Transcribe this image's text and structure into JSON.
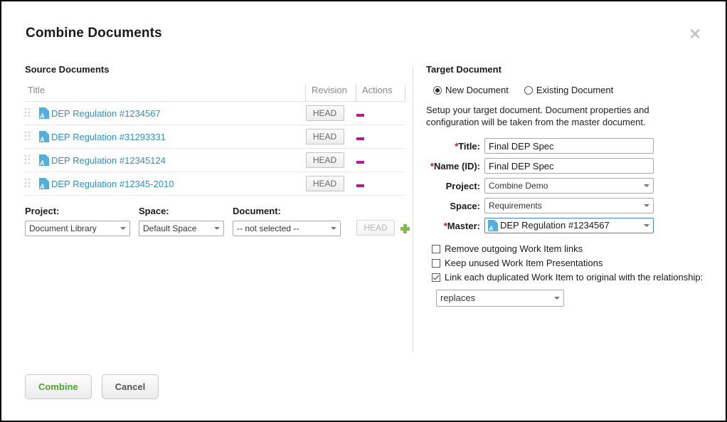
{
  "dialog": {
    "title": "Combine Documents",
    "close_icon": "close-icon"
  },
  "source": {
    "heading": "Source Documents",
    "columns": {
      "title": "Title",
      "revision": "Revision",
      "actions": "Actions"
    },
    "rows": [
      {
        "title": "DEP Regulation #1234567",
        "revision": "HEAD",
        "icon": "document-icon",
        "action_icon": "remove-icon"
      },
      {
        "title": "DEP Regulation #31293331",
        "revision": "HEAD",
        "icon": "document-icon",
        "action_icon": "remove-icon"
      },
      {
        "title": "DEP Regulation #12345124",
        "revision": "HEAD",
        "icon": "document-icon",
        "action_icon": "remove-icon"
      },
      {
        "title": "DEP Regulation #12345-2010",
        "revision": "HEAD",
        "icon": "document-icon",
        "action_icon": "remove-icon"
      }
    ],
    "selectors": {
      "project_label": "Project:",
      "project_value": "Document Library",
      "space_label": "Space:",
      "space_value": "Default Space",
      "document_label": "Document:",
      "document_value": "-- not selected --",
      "head_button": "HEAD",
      "add_icon": "plus-icon"
    }
  },
  "target": {
    "heading": "Target Document",
    "mode": {
      "new_label": "New Document",
      "existing_label": "Existing Document",
      "selected": "New Document"
    },
    "help_text": "Setup your target document. Document properties and configuration will be taken from the master document.",
    "fields": {
      "title_label": "Title:",
      "title_value": "Final DEP Spec",
      "name_label": "Name (ID):",
      "name_value": "Final DEP Spec",
      "project_label": "Project:",
      "project_value": "Combine Demo",
      "space_label": "Space:",
      "space_value": "Requirements",
      "master_label": "Master:",
      "master_value": "DEP Regulation #1234567",
      "required_marker": "*"
    },
    "options": [
      {
        "label": "Remove outgoing Work Item links",
        "checked": false
      },
      {
        "label": "Keep unused Work Item Presentations",
        "checked": false
      },
      {
        "label": "Link each duplicated Work Item to original with the relationship:",
        "checked": true
      }
    ],
    "relationship_value": "replaces"
  },
  "footer": {
    "combine_label": "Combine",
    "cancel_label": "Cancel"
  },
  "colors": {
    "link": "#2c8fc9",
    "doc_icon": "#4fb0dd",
    "remove_icon": "#b5179e",
    "add_icon": "#7ac143",
    "required": "#d01414",
    "combine_text": "#4aa829"
  }
}
